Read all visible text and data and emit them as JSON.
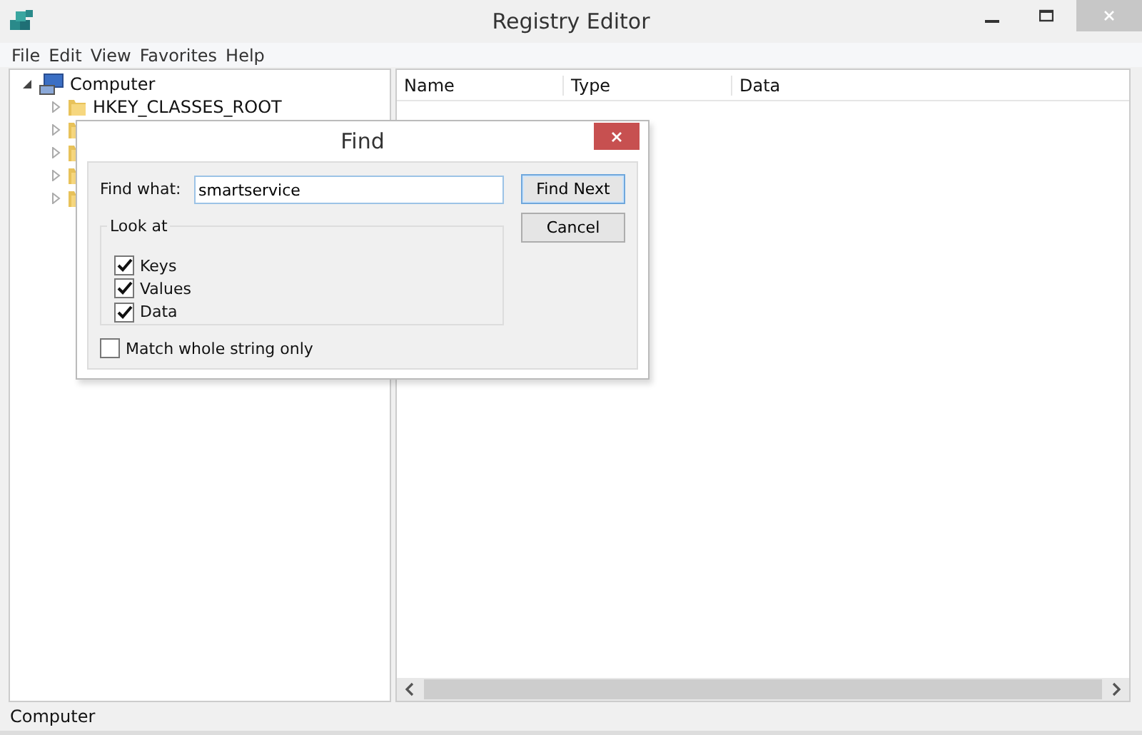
{
  "window": {
    "title": "Registry Editor"
  },
  "menu": [
    "File",
    "Edit",
    "View",
    "Favorites",
    "Help"
  ],
  "tree": [
    {
      "label": "Computer",
      "expanded": true,
      "children": [
        {
          "label": "HKEY_CLASSES_ROOT",
          "expanded": false
        },
        {
          "expanded": false
        },
        {
          "expanded": false
        },
        {
          "expanded": false
        },
        {
          "expanded": false
        }
      ]
    }
  ],
  "list": {
    "columns": [
      "Name",
      "Type",
      "Data"
    ]
  },
  "status_bar": "Computer",
  "dialog": {
    "title": "Find",
    "find_label": "Find what:",
    "find_value": "smartservice",
    "group_label": "Look at",
    "options": [
      {
        "label": "Keys",
        "checked": true
      },
      {
        "label": "Values",
        "checked": true
      },
      {
        "label": "Data",
        "checked": true
      }
    ],
    "match_whole": {
      "label": "Match whole string only",
      "checked": false
    },
    "buttons": [
      {
        "label": "Find Next",
        "default": true
      },
      {
        "label": "Cancel",
        "default": false
      }
    ]
  }
}
